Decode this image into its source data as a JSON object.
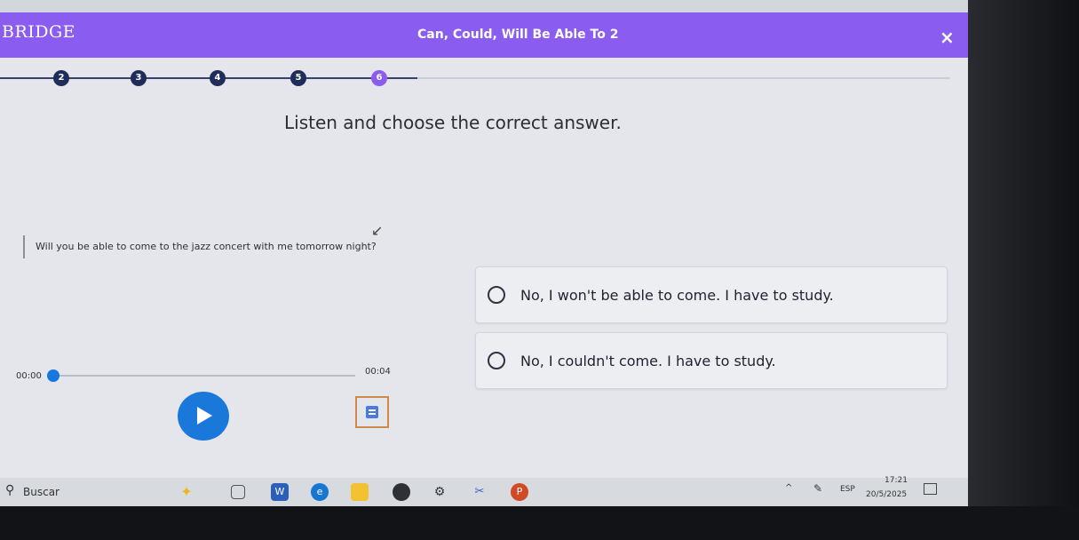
{
  "header": {
    "brand": "BRIDGE",
    "lesson_title": "Can, Could, Will Be Able To 2",
    "close_symbol": "×"
  },
  "progress": {
    "steps": [
      "2",
      "3",
      "4",
      "5",
      "6"
    ],
    "current_step": "6"
  },
  "instruction": "Listen and choose the correct answer.",
  "question": "Will you be able to come to the jazz concert with me tomorrow night?",
  "options": [
    {
      "label": "No, I won't be able to come. I have to study."
    },
    {
      "label": "No, I couldn't come. I have to study."
    }
  ],
  "audio": {
    "time_start": "00:00",
    "time_end": "00:04",
    "progress": 0
  },
  "taskbar": {
    "search_label": "Buscar",
    "language": "ESP",
    "time": "17:21",
    "date": "20/5/2025"
  },
  "colors": {
    "header": "#8a5cf0",
    "accent_blue": "#1b78db",
    "step_done": "#1f2d5a"
  }
}
